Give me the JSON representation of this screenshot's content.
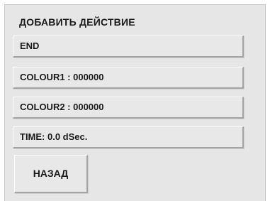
{
  "dialog": {
    "title": "ДОБАВИТЬ ДЕЙСТВИЕ",
    "fields": [
      {
        "label": "END"
      },
      {
        "label": "COLOUR1 : 000000"
      },
      {
        "label": "COLOUR2 : 000000"
      },
      {
        "label": "TIME: 0.0 dSec."
      }
    ],
    "back_label": "НАЗАД"
  }
}
